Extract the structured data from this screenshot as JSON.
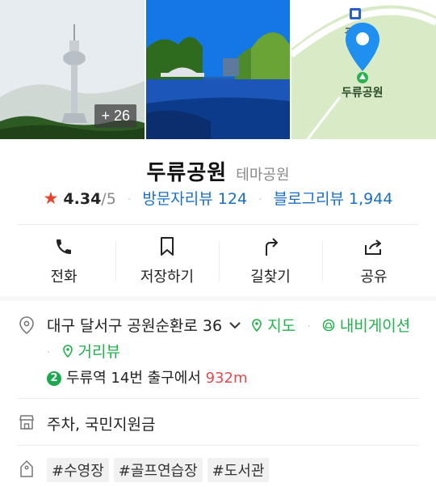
{
  "photos": {
    "more_count": "+ 26",
    "map_labels": {
      "station": "광장",
      "place": "두류공원"
    }
  },
  "place": {
    "name": "두류공원",
    "category": "테마공원"
  },
  "rating": {
    "star": "★",
    "score": "4.34",
    "max": "/5",
    "visitor_reviews": "방문자리뷰 124",
    "blog_reviews": "블로그리뷰 1,944",
    "separator": "·"
  },
  "actions": [
    {
      "label": "전화",
      "icon": "phone-icon"
    },
    {
      "label": "저장하기",
      "icon": "bookmark-icon"
    },
    {
      "label": "길찾기",
      "icon": "directions-icon"
    },
    {
      "label": "공유",
      "icon": "share-icon"
    }
  ],
  "address": {
    "text": "대구 달서구 공원순환로 36",
    "map_link": "지도",
    "navigation_link": "내비게이션",
    "street_view_link": "거리뷰",
    "separator": "·"
  },
  "subway": {
    "line_number": "2",
    "station": "두류역",
    "exit": "14번 출구에서",
    "distance": "932m"
  },
  "facilities": "주차, 국민지원금",
  "tags": [
    "#수영장",
    "#골프연습장",
    "#도서관"
  ],
  "colors": {
    "accent_green": "#21b04b",
    "link_blue": "#1a6fc4",
    "star_red": "#e8412c",
    "map_pin": "#1f8ff0"
  }
}
